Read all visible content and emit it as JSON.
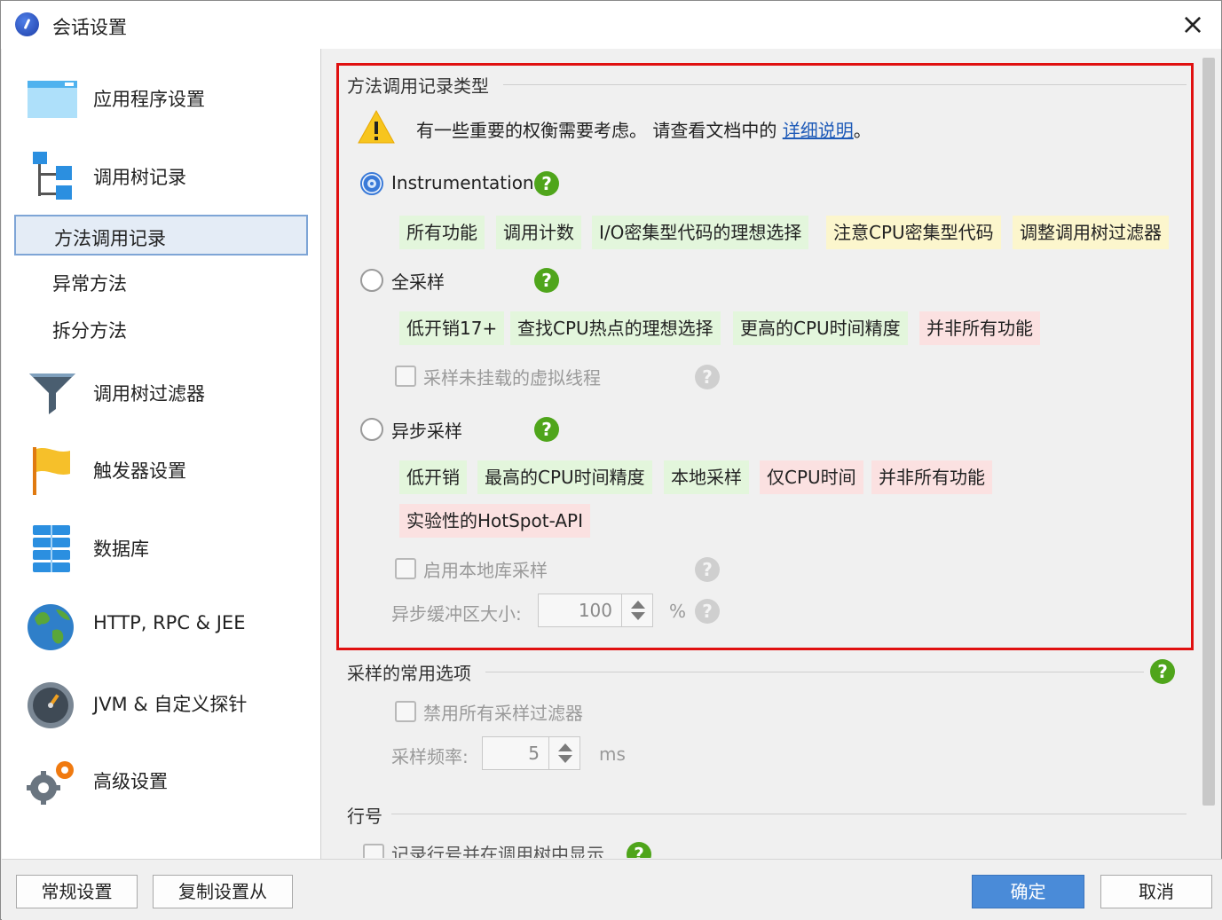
{
  "window": {
    "title": "会话设置",
    "close_icon": "×"
  },
  "sidebar": {
    "items": [
      {
        "label": "应用程序设置",
        "icon": "window-icon"
      },
      {
        "label": "调用树记录",
        "icon": "tree-icon"
      },
      {
        "label": "方法调用记录",
        "sub": true,
        "selected": true
      },
      {
        "label": "异常方法",
        "sub": true
      },
      {
        "label": "拆分方法",
        "sub": true
      },
      {
        "label": "调用树过滤器",
        "icon": "funnel-icon"
      },
      {
        "label": "触发器设置",
        "icon": "flag-icon"
      },
      {
        "label": "数据库",
        "icon": "database-icon"
      },
      {
        "label": "HTTP, RPC & JEE",
        "icon": "globe-icon"
      },
      {
        "label": "JVM & 自定义探针",
        "icon": "gauge-icon"
      },
      {
        "label": "高级设置",
        "icon": "gears-icon"
      }
    ]
  },
  "method_call": {
    "section_title": "方法调用记录类型",
    "note_text": "有一些重要的权衡需要考虑。 请查看文档中的 ",
    "note_link": "详细说明",
    "note_end": "。",
    "instrumentation": {
      "label": "Instrumentation",
      "checked": true,
      "tags": [
        {
          "text": "所有功能",
          "kind": "green"
        },
        {
          "text": "调用计数",
          "kind": "green"
        },
        {
          "text": "I/O密集型代码的理想选择",
          "kind": "green"
        },
        {
          "text": "注意CPU密集型代码",
          "kind": "yellow"
        },
        {
          "text": "调整调用树过滤器",
          "kind": "yellow"
        }
      ]
    },
    "full_sampling": {
      "label": "全采样",
      "checked": false,
      "tags": [
        {
          "text": "低开销17+",
          "kind": "green"
        },
        {
          "text": "查找CPU热点的理想选择",
          "kind": "green"
        },
        {
          "text": "更高的CPU时间精度",
          "kind": "green"
        },
        {
          "text": "并非所有功能",
          "kind": "red"
        }
      ],
      "option_label": "采样未挂载的虚拟线程"
    },
    "async_sampling": {
      "label": "异步采样",
      "checked": false,
      "tags": [
        {
          "text": "低开销",
          "kind": "green"
        },
        {
          "text": "最高的CPU时间精度",
          "kind": "green"
        },
        {
          "text": "本地采样",
          "kind": "green"
        },
        {
          "text": "仅CPU时间",
          "kind": "red"
        },
        {
          "text": "并非所有功能",
          "kind": "red"
        },
        {
          "text": "实验性的HotSpot-API",
          "kind": "red"
        }
      ],
      "native_label": "启用本地库采样",
      "buffer_label": "异步缓冲区大小:",
      "buffer_value": "100",
      "buffer_unit": "%"
    }
  },
  "sampling_common": {
    "section_title": "采样的常用选项",
    "disable_filters_label": "禁用所有采样过滤器",
    "frequency_label": "采样频率:",
    "frequency_value": "5",
    "frequency_unit": "ms"
  },
  "line_numbers": {
    "section_title": "行号",
    "option_label": "记录行号并在调用树中显示"
  },
  "help_glyph": "?",
  "footer": {
    "general_settings": "常规设置",
    "copy_settings_from": "复制设置从",
    "ok": "确定",
    "cancel": "取消"
  }
}
